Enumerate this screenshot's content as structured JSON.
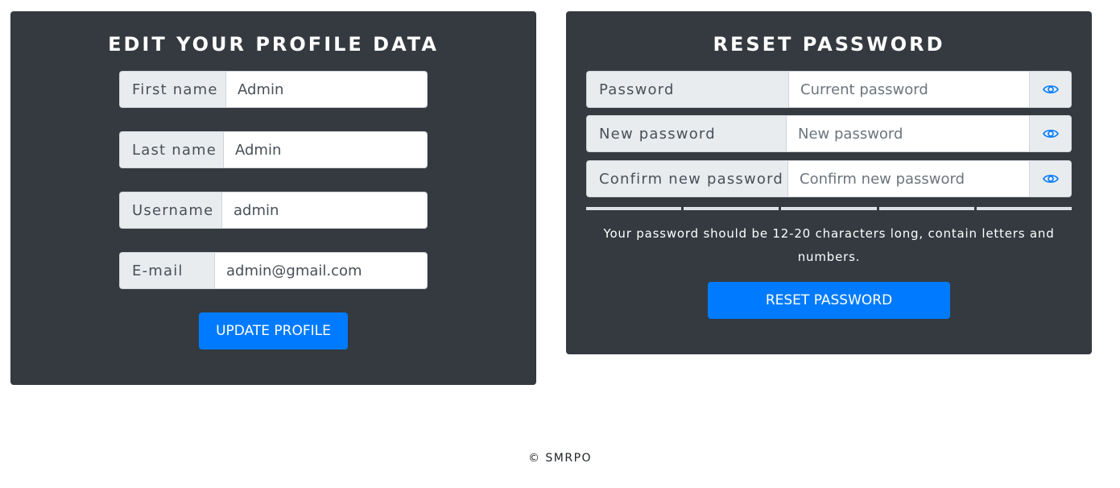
{
  "profile": {
    "title": "EDIT YOUR PROFILE DATA",
    "fields": [
      {
        "label": "First name",
        "value": "Admin"
      },
      {
        "label": "Last name",
        "value": "Admin"
      },
      {
        "label": "Username",
        "value": "admin"
      },
      {
        "label": "E-mail",
        "value": "admin@gmail.com"
      }
    ],
    "submit_label": "UPDATE PROFILE"
  },
  "password": {
    "title": "RESET PASSWORD",
    "fields": [
      {
        "label": "Password",
        "placeholder": "Current password",
        "icon": "eye-icon"
      },
      {
        "label": "New password",
        "placeholder": "New password",
        "icon": "eye-icon"
      },
      {
        "label": "Confirm new password",
        "placeholder": "Confirm new password",
        "icon": "eye-icon"
      }
    ],
    "strength_segments": 5,
    "hint": "Your password should be 12-20 characters long, contain letters and numbers.",
    "submit_label": "RESET PASSWORD"
  },
  "footer": {
    "text": "© SMRPO"
  },
  "colors": {
    "card_bg": "#343a40",
    "primary": "#007bff",
    "addon_bg": "#e9ecef"
  }
}
